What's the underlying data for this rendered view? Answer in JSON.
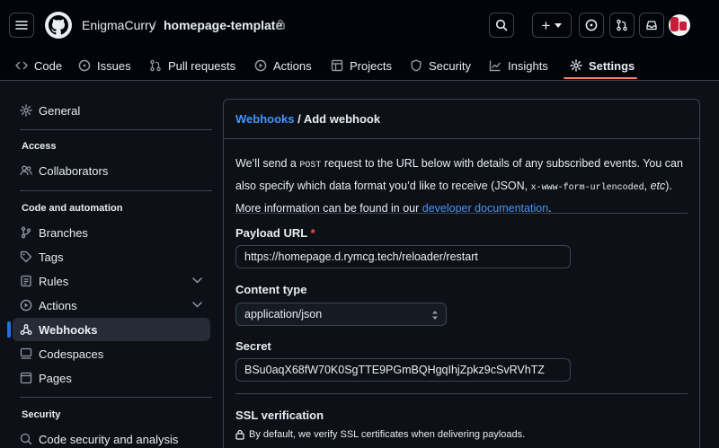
{
  "header": {
    "owner": "EnigmaCurry",
    "separator": "/",
    "repo": "homepage-template",
    "create_label": "+"
  },
  "nav": {
    "tabs": [
      {
        "label": "Code",
        "icon": "code-icon"
      },
      {
        "label": "Issues",
        "icon": "issue-icon"
      },
      {
        "label": "Pull requests",
        "icon": "pull-request-icon"
      },
      {
        "label": "Actions",
        "icon": "play-icon"
      },
      {
        "label": "Projects",
        "icon": "table-icon"
      },
      {
        "label": "Security",
        "icon": "shield-icon"
      },
      {
        "label": "Insights",
        "icon": "graph-icon"
      },
      {
        "label": "Settings",
        "icon": "gear-icon"
      }
    ],
    "active": "Settings"
  },
  "sidebar": {
    "general": "General",
    "access_heading": "Access",
    "collaborators": "Collaborators",
    "code_heading": "Code and automation",
    "branches": "Branches",
    "tags": "Tags",
    "rules": "Rules",
    "actions": "Actions",
    "webhooks": "Webhooks",
    "codespaces": "Codespaces",
    "pages": "Pages",
    "security_heading": "Security",
    "code_security": "Code security and analysis"
  },
  "main": {
    "breadcrumb_link": "Webhooks",
    "breadcrumb_rest": " / Add webhook",
    "intro": {
      "p1": "We’ll send a ",
      "post": "POST",
      "p2": " request to the URL below with details of any subscribed events. You can also specify which data format you’d like to receive (JSON, ",
      "form_mono": "x-www-form-urlencoded",
      "p3": ", ",
      "etc": "etc",
      "p4": "). More information can be found in our ",
      "docs_link": "developer documentation",
      "p5": "."
    },
    "payload_label": "Payload URL",
    "required_mark": "*",
    "payload_value": "https://homepage.d.rymcg.tech/reloader/restart",
    "content_type_label": "Content type",
    "content_type_value": "application/json",
    "secret_label": "Secret",
    "secret_value": "BSu0aqX68fW70K0SgTTE9PGmBQHgqIhjZpkz9cSvRVhTZ",
    "ssl_label": "SSL verification",
    "ssl_note": "By default, we verify SSL certificates when delivering payloads."
  },
  "colors": {
    "background": "#0d1117",
    "accent_link": "#4493f8",
    "active_tab_underline": "#f78166",
    "required": "#f85149"
  }
}
